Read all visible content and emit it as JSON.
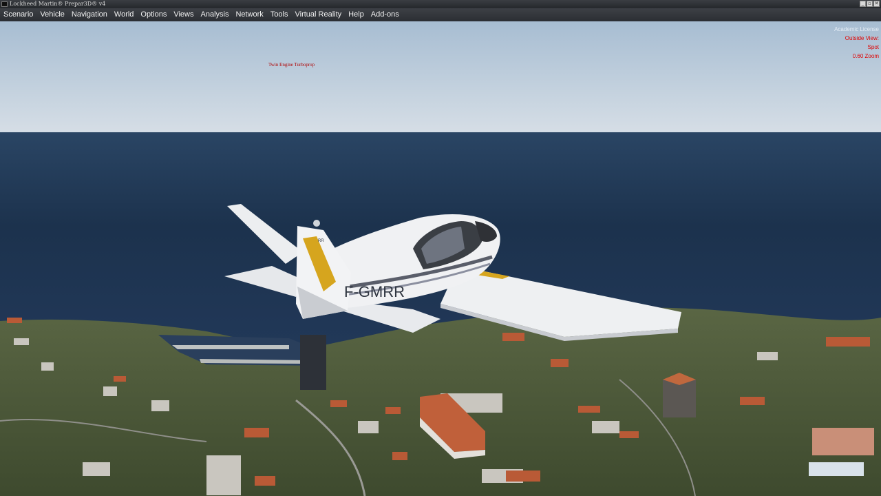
{
  "window": {
    "title": "Lockheed Martin® Prepar3D® v4",
    "buttons": [
      "_",
      "▫",
      "✕"
    ]
  },
  "menu": {
    "items": [
      "Scenario",
      "Vehicle",
      "Navigation",
      "World",
      "Options",
      "Views",
      "Analysis",
      "Network",
      "Tools",
      "Virtual Reality",
      "Help",
      "Add-ons"
    ]
  },
  "overlay": {
    "license": "Academic License",
    "view_lines": [
      "Outside View:",
      "Spot",
      "0.60 Zoom"
    ],
    "aircraft_label": "Twin Engine Turboprop"
  },
  "aircraft": {
    "registration": "F-GMRR",
    "tail_mark": "RR"
  },
  "colors": {
    "accent_red": "#e00000",
    "aircraft_stripe": "#d6a51e"
  }
}
